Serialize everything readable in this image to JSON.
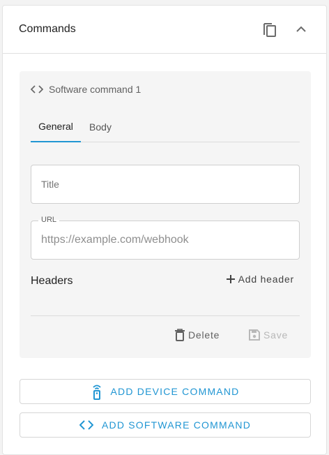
{
  "card": {
    "title": "Commands",
    "icons": {
      "copy": "copy-icon",
      "collapse": "chevron-up-icon"
    }
  },
  "command": {
    "name": "Software command 1",
    "icon": "code-brackets-icon",
    "tabs": [
      {
        "label": "General",
        "active": true
      },
      {
        "label": "Body",
        "active": false
      }
    ],
    "fields": {
      "title": {
        "placeholder": "Title",
        "value": ""
      },
      "url": {
        "label": "URL",
        "placeholder": "https://example.com/webhook",
        "value": ""
      }
    },
    "headers": {
      "label": "Headers",
      "add_label": "Add header"
    },
    "actions": {
      "delete_label": "Delete",
      "save_label": "Save",
      "save_disabled": true
    }
  },
  "add_buttons": {
    "device": {
      "label": "ADD DEVICE COMMAND",
      "icon": "remote-control-icon"
    },
    "software": {
      "label": "ADD SOFTWARE COMMAND",
      "icon": "code-brackets-icon"
    }
  },
  "colors": {
    "accent": "#2196d3",
    "panel": "#f5f5f5",
    "disabled": "#b8b8b8"
  }
}
